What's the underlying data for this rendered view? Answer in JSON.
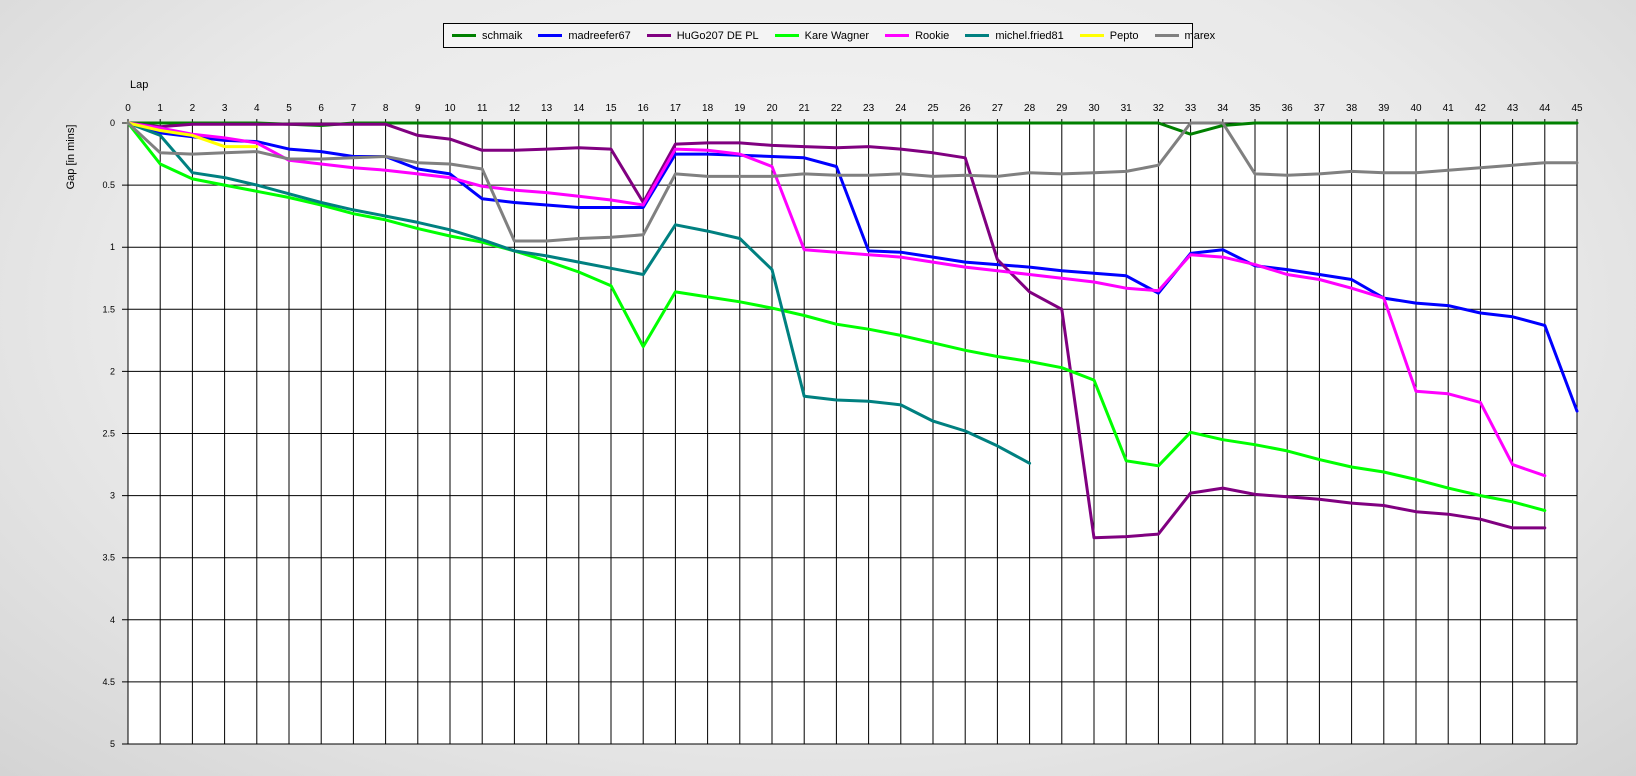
{
  "chart_data": {
    "type": "line",
    "xlabel": "Lap",
    "ylabel": "Gap [in mins]",
    "xlim": [
      0,
      45
    ],
    "ylim": [
      0,
      5
    ],
    "y_inverted": true,
    "grid": true,
    "legend_position": "top-center",
    "x_ticks": [
      0,
      1,
      2,
      3,
      4,
      5,
      6,
      7,
      8,
      9,
      10,
      11,
      12,
      13,
      14,
      15,
      16,
      17,
      18,
      19,
      20,
      21,
      22,
      23,
      24,
      25,
      26,
      27,
      28,
      29,
      30,
      31,
      32,
      33,
      34,
      35,
      36,
      37,
      38,
      39,
      40,
      41,
      42,
      43,
      44,
      45
    ],
    "y_ticks": [
      {
        "v": 0,
        "label": "0"
      },
      {
        "v": 0.5,
        "label": "0.5"
      },
      {
        "v": 1,
        "label": "1"
      },
      {
        "v": 1.5,
        "label": "1.5"
      },
      {
        "v": 2,
        "label": "2"
      },
      {
        "v": 2.5,
        "label": "2.5"
      },
      {
        "v": 3,
        "label": "3"
      },
      {
        "v": 3.5,
        "label": "3.5"
      },
      {
        "v": 4,
        "label": "4"
      },
      {
        "v": 4.5,
        "label": "4.5"
      },
      {
        "v": 5,
        "label": "5"
      }
    ],
    "series": [
      {
        "name": "schmaik",
        "color": "#008000",
        "x": [
          0,
          1,
          2,
          3,
          4,
          5,
          6,
          7,
          8,
          9,
          10,
          11,
          12,
          13,
          14,
          15,
          16,
          17,
          18,
          19,
          20,
          21,
          22,
          23,
          24,
          25,
          26,
          27,
          28,
          29,
          30,
          31,
          32,
          33,
          34,
          35,
          36,
          37,
          38,
          39,
          40,
          41,
          42,
          43,
          44,
          45
        ],
        "y": [
          0,
          0,
          0,
          0,
          0,
          0.01,
          0.02,
          0,
          0,
          0,
          0,
          0,
          0,
          0,
          0,
          0,
          0,
          0,
          0,
          0,
          0,
          0,
          0,
          0,
          0,
          0,
          0,
          0,
          0,
          0,
          0,
          0,
          0,
          0.09,
          0.02,
          0,
          0,
          0,
          0,
          0,
          0,
          0,
          0,
          0,
          0,
          0
        ]
      },
      {
        "name": "madreefer67",
        "color": "#0000ff",
        "x": [
          0,
          1,
          2,
          3,
          4,
          5,
          6,
          7,
          8,
          9,
          10,
          11,
          12,
          13,
          14,
          15,
          16,
          17,
          18,
          19,
          20,
          21,
          22,
          23,
          24,
          25,
          26,
          27,
          28,
          29,
          30,
          31,
          32,
          33,
          34,
          35,
          36,
          37,
          38,
          39,
          40,
          41,
          42,
          43,
          44,
          45
        ],
        "y": [
          0,
          0.08,
          0.11,
          0.14,
          0.15,
          0.21,
          0.23,
          0.27,
          0.27,
          0.37,
          0.41,
          0.61,
          0.64,
          0.66,
          0.68,
          0.68,
          0.68,
          0.25,
          0.25,
          0.26,
          0.27,
          0.28,
          0.35,
          1.03,
          1.04,
          1.08,
          1.12,
          1.14,
          1.16,
          1.19,
          1.21,
          1.23,
          1.37,
          1.05,
          1.02,
          1.15,
          1.18,
          1.22,
          1.26,
          1.41,
          1.45,
          1.47,
          1.53,
          1.56,
          1.63,
          2.32
        ]
      },
      {
        "name": "HuGo207 DE PL",
        "color": "#800080",
        "x": [
          0,
          1,
          2,
          3,
          4,
          5,
          6,
          7,
          8,
          9,
          10,
          11,
          12,
          13,
          14,
          15,
          16,
          17,
          18,
          19,
          20,
          21,
          22,
          23,
          24,
          25,
          26,
          27,
          28,
          29,
          30,
          31,
          32,
          33,
          34,
          35,
          36,
          37,
          38,
          39,
          40,
          41,
          42,
          43,
          44
        ],
        "y": [
          0,
          0.03,
          0.01,
          0.01,
          0.01,
          0.01,
          0.01,
          0.01,
          0.01,
          0.1,
          0.13,
          0.22,
          0.22,
          0.21,
          0.2,
          0.21,
          0.64,
          0.17,
          0.16,
          0.16,
          0.18,
          0.19,
          0.2,
          0.19,
          0.21,
          0.24,
          0.28,
          1.1,
          1.36,
          1.5,
          3.34,
          3.33,
          3.31,
          2.98,
          2.94,
          2.99,
          3.01,
          3.03,
          3.06,
          3.08,
          3.13,
          3.15,
          3.19,
          3.26,
          3.26
        ]
      },
      {
        "name": "Kare Wagner",
        "color": "#00ff00",
        "x": [
          0,
          1,
          2,
          3,
          4,
          5,
          6,
          7,
          8,
          9,
          10,
          11,
          12,
          13,
          14,
          15,
          16,
          17,
          18,
          19,
          20,
          21,
          22,
          23,
          24,
          25,
          26,
          27,
          28,
          29,
          30,
          31,
          32,
          33,
          34,
          35,
          36,
          37,
          38,
          39,
          40,
          41,
          42,
          43,
          44
        ],
        "y": [
          0,
          0.33,
          0.45,
          0.5,
          0.55,
          0.6,
          0.66,
          0.73,
          0.78,
          0.85,
          0.91,
          0.96,
          1.03,
          1.11,
          1.2,
          1.31,
          1.8,
          1.36,
          1.4,
          1.44,
          1.49,
          1.55,
          1.62,
          1.66,
          1.71,
          1.77,
          1.83,
          1.88,
          1.92,
          1.97,
          2.07,
          2.72,
          2.76,
          2.49,
          2.55,
          2.59,
          2.64,
          2.71,
          2.77,
          2.81,
          2.87,
          2.94,
          3.0,
          3.05,
          3.12
        ]
      },
      {
        "name": "Rookie",
        "color": "#ff00ff",
        "x": [
          0,
          1,
          2,
          3,
          4,
          5,
          6,
          7,
          8,
          9,
          10,
          11,
          12,
          13,
          14,
          15,
          16,
          17,
          18,
          19,
          20,
          21,
          22,
          23,
          24,
          25,
          26,
          27,
          28,
          29,
          30,
          31,
          32,
          33,
          34,
          35,
          36,
          37,
          38,
          39,
          40,
          41,
          42,
          43,
          44
        ],
        "y": [
          0,
          0.04,
          0.09,
          0.12,
          0.16,
          0.3,
          0.33,
          0.36,
          0.38,
          0.41,
          0.44,
          0.51,
          0.54,
          0.56,
          0.59,
          0.62,
          0.66,
          0.21,
          0.22,
          0.25,
          0.35,
          1.02,
          1.04,
          1.06,
          1.08,
          1.12,
          1.16,
          1.19,
          1.22,
          1.25,
          1.28,
          1.33,
          1.35,
          1.06,
          1.08,
          1.14,
          1.22,
          1.26,
          1.33,
          1.41,
          2.16,
          2.18,
          2.25,
          2.75,
          2.84
        ]
      },
      {
        "name": "michel.fried81",
        "color": "#008080",
        "x": [
          0,
          1,
          2,
          3,
          4,
          5,
          6,
          7,
          8,
          9,
          10,
          11,
          12,
          13,
          14,
          15,
          16,
          17,
          18,
          19,
          20,
          21,
          22,
          23,
          24,
          25,
          26,
          27,
          28
        ],
        "y": [
          0,
          0.1,
          0.4,
          0.44,
          0.5,
          0.57,
          0.64,
          0.7,
          0.75,
          0.8,
          0.86,
          0.94,
          1.03,
          1.07,
          1.12,
          1.17,
          1.22,
          0.82,
          0.87,
          0.93,
          1.18,
          2.2,
          2.23,
          2.24,
          2.27,
          2.4,
          2.48,
          2.6,
          2.74
        ]
      },
      {
        "name": "Pepto",
        "color": "#ffff00",
        "x": [
          0,
          1,
          2,
          3,
          4
        ],
        "y": [
          0,
          0.06,
          0.1,
          0.19,
          0.19
        ]
      },
      {
        "name": "marex",
        "color": "#808080",
        "x": [
          0,
          1,
          2,
          3,
          4,
          5,
          6,
          7,
          8,
          9,
          10,
          11,
          12,
          13,
          14,
          15,
          16,
          17,
          18,
          19,
          20,
          21,
          22,
          23,
          24,
          25,
          26,
          27,
          28,
          29,
          30,
          31,
          32,
          33,
          34,
          35,
          36,
          37,
          38,
          39,
          40,
          41,
          42,
          43,
          44,
          45
        ],
        "y": [
          0,
          0.24,
          0.25,
          0.24,
          0.23,
          0.29,
          0.29,
          0.28,
          0.27,
          0.32,
          0.33,
          0.37,
          0.95,
          0.95,
          0.93,
          0.92,
          0.9,
          0.41,
          0.43,
          0.43,
          0.43,
          0.41,
          0.42,
          0.42,
          0.41,
          0.43,
          0.42,
          0.43,
          0.4,
          0.41,
          0.4,
          0.39,
          0.34,
          0,
          0,
          0.41,
          0.42,
          0.41,
          0.39,
          0.4,
          0.4,
          0.38,
          0.36,
          0.34,
          0.32,
          0.32
        ]
      }
    ]
  }
}
